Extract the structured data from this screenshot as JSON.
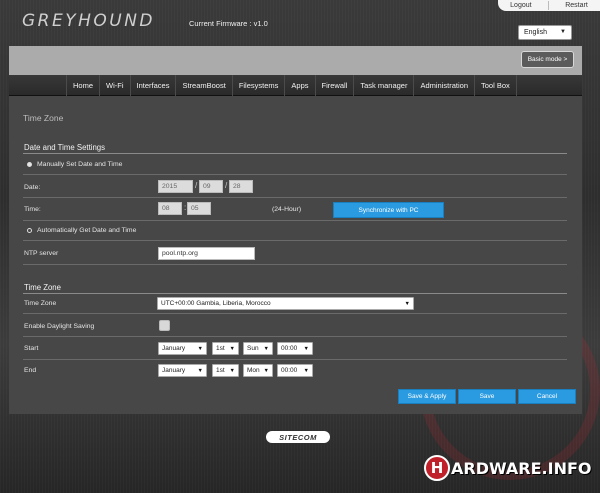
{
  "header": {
    "logo": "GREYHOUND",
    "firmware": "Current Firmware : v1.0",
    "logout": "Logout",
    "restart": "Restart",
    "language": "English"
  },
  "mode_button": "Basic mode >",
  "nav": [
    "Home",
    "Wi-Fi",
    "Interfaces",
    "StreamBoost",
    "Filesystems",
    "Apps",
    "Firewall",
    "Task manager",
    "Administration",
    "Tool Box"
  ],
  "page_title": "Time Zone",
  "datetime": {
    "section_title": "Date and Time Settings",
    "manual_label": "Manually Set Date and Time",
    "date_label": "Date:",
    "date_year": "2015",
    "date_month": "09",
    "date_day": "28",
    "time_label": "Time:",
    "time_hour": "08",
    "time_minute": "05",
    "time_format": "(24-Hour)",
    "sync_button": "Synchronize with PC",
    "auto_label": "Automatically Get Date and Time",
    "ntp_label": "NTP server",
    "ntp_value": "pool.ntp.org"
  },
  "timezone": {
    "section_title": "Time Zone",
    "tz_label": "Time Zone",
    "tz_value": "UTC+00:00 Gambia, Liberia, Morocco",
    "dst_label": "Enable Daylight Saving",
    "start_label": "Start",
    "start_month": "January",
    "start_week": "1st",
    "start_day": "Sun",
    "start_time": "00:00",
    "end_label": "End",
    "end_month": "January",
    "end_week": "1st",
    "end_day": "Mon",
    "end_time": "00:00"
  },
  "buttons": {
    "save_apply": "Save & Apply",
    "save": "Save",
    "cancel": "Cancel"
  },
  "footer": {
    "brand": "SITECOM",
    "watermark_badge": "H",
    "watermark_text": "ARDWARE.INFO"
  },
  "colors": {
    "accent_blue": "#2a9be0",
    "panel": "#474747",
    "band": "#ababab"
  }
}
